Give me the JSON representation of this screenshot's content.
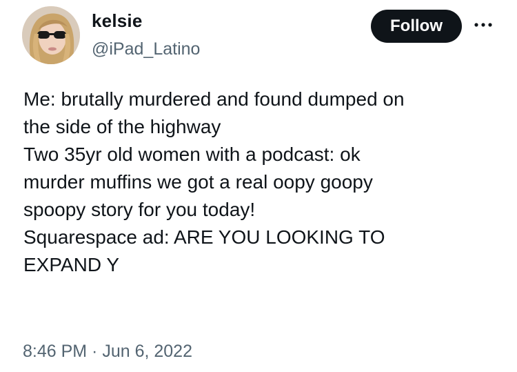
{
  "author": {
    "display_name": "kelsie",
    "handle": "@iPad_Latino"
  },
  "header": {
    "follow_label": "Follow",
    "more_icon": "more-horizontal-icon"
  },
  "tweet": {
    "lines": [
      "Me: brutally murdered and found dumped on",
      "the side of the highway",
      "Two 35yr old women with a podcast: ok",
      "murder muffins we got a real oopy goopy",
      "spoopy story for you today!",
      "Squarespace ad: ARE YOU LOOKING TO",
      "EXPAND Y"
    ],
    "time": "8:46 PM",
    "separator": " · ",
    "date": "Jun 6, 2022"
  },
  "colors": {
    "text_primary": "#0f1419",
    "text_secondary": "#536471",
    "follow_bg": "#0f1419",
    "background": "#ffffff"
  }
}
